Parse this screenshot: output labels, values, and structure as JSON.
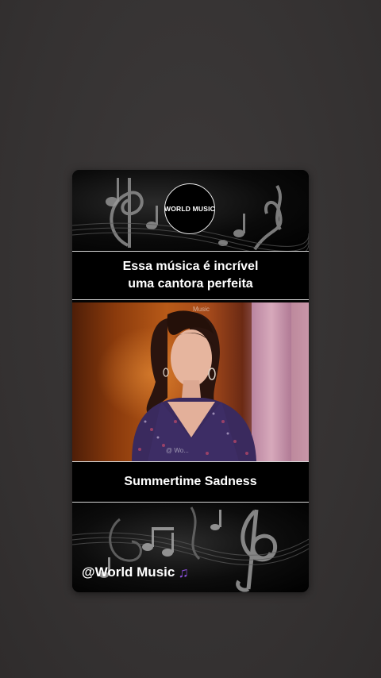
{
  "logo": {
    "text": "WORLD MUSIC"
  },
  "caption": {
    "line1": "Essa música é incrível",
    "line2": "uma cantora perfeita"
  },
  "video": {
    "watermark_top": "Music",
    "watermark_bottom": "@ Wo..."
  },
  "song": {
    "title": "Summertime Sadness"
  },
  "footer": {
    "handle": "@World Music",
    "icon": "music-note-icon"
  },
  "colors": {
    "background": "#363333",
    "card": "#050505",
    "note_accent": "#8a4fd8"
  }
}
